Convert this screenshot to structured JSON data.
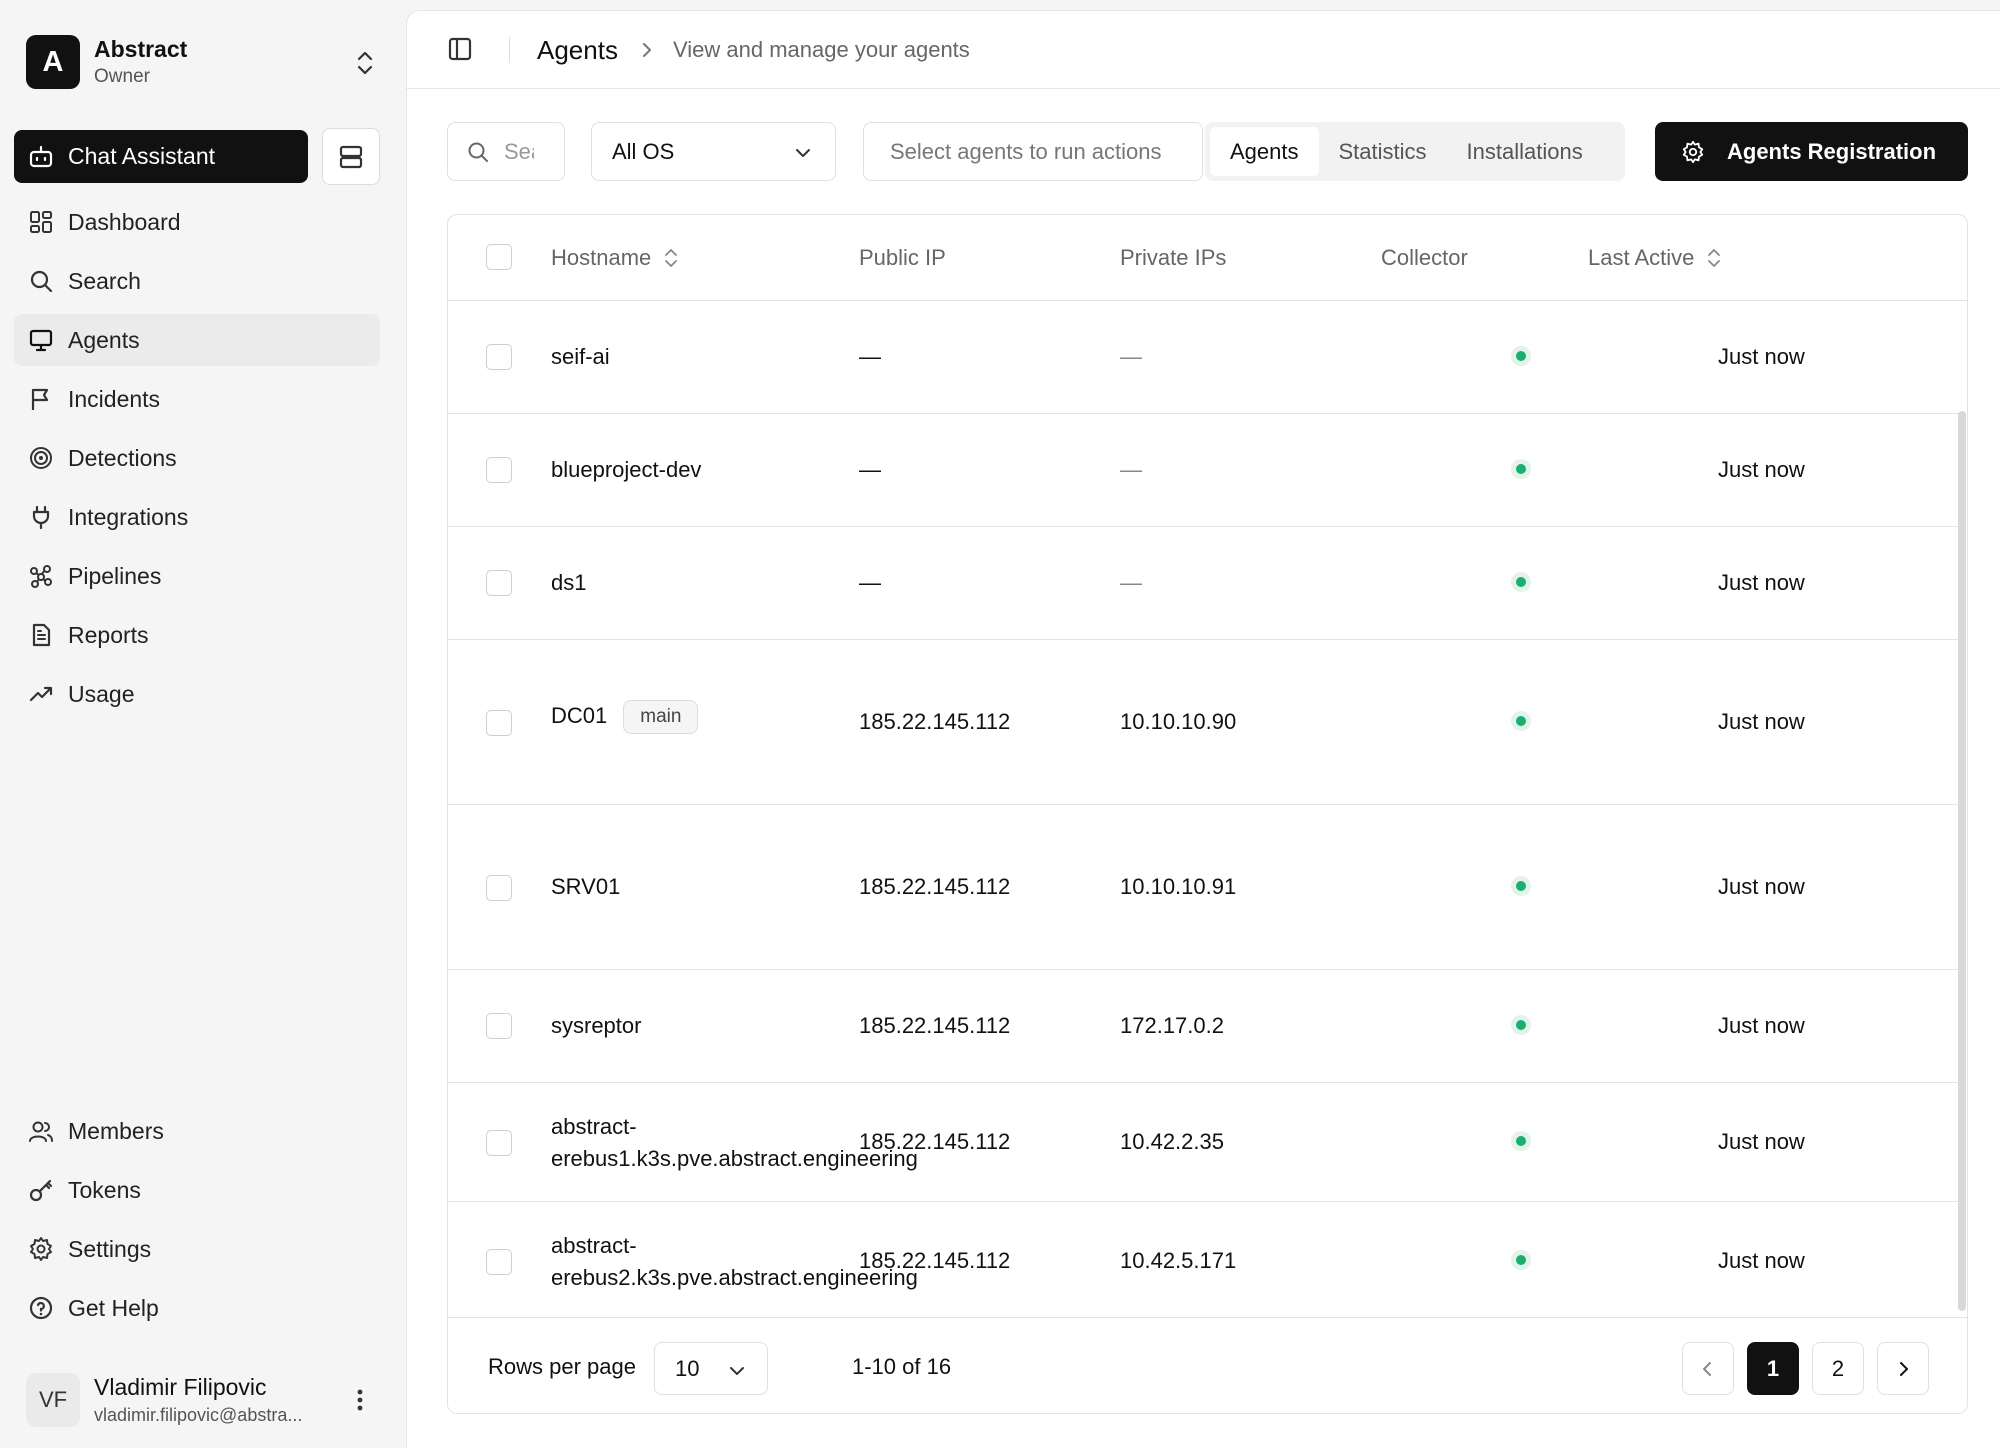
{
  "org": {
    "initial": "A",
    "name": "Abstract",
    "role": "Owner"
  },
  "sidebar": {
    "chat_label": "Chat Assistant",
    "items": [
      {
        "label": "Dashboard",
        "icon": "dashboard-icon"
      },
      {
        "label": "Search",
        "icon": "search-icon"
      },
      {
        "label": "Agents",
        "icon": "monitor-icon",
        "active": true
      },
      {
        "label": "Incidents",
        "icon": "flag-icon"
      },
      {
        "label": "Detections",
        "icon": "radar-icon"
      },
      {
        "label": "Integrations",
        "icon": "plug-icon"
      },
      {
        "label": "Pipelines",
        "icon": "workflow-icon"
      },
      {
        "label": "Reports",
        "icon": "file-text-icon"
      },
      {
        "label": "Usage",
        "icon": "trending-up-icon"
      }
    ],
    "bottom_items": [
      {
        "label": "Members",
        "icon": "users-icon"
      },
      {
        "label": "Tokens",
        "icon": "key-icon"
      },
      {
        "label": "Settings",
        "icon": "gear-icon"
      },
      {
        "label": "Get Help",
        "icon": "help-circle-icon"
      }
    ]
  },
  "user": {
    "initials": "VF",
    "name": "Vladimir Filipovic",
    "email": "vladimir.filipovic@abstra..."
  },
  "header": {
    "title": "Agents",
    "subtitle": "View and manage your agents"
  },
  "toolbar": {
    "search_placeholder": "Search",
    "os_filter": "All OS",
    "actions_placeholder": "Select agents to run actions",
    "tabs": [
      "Agents",
      "Statistics",
      "Installations"
    ],
    "active_tab": "Agents",
    "register_label": "Agents Registration"
  },
  "table": {
    "columns": {
      "hostname": "Hostname",
      "public_ip": "Public IP",
      "private_ips": "Private IPs",
      "collector": "Collector",
      "last_active": "Last Active"
    },
    "rows": [
      {
        "hostname": "seif-ai",
        "public_ip": "—",
        "private_ips": "—",
        "collector": "active",
        "last_active": "Just now"
      },
      {
        "hostname": "blueproject-dev",
        "public_ip": "—",
        "private_ips": "—",
        "collector": "active",
        "last_active": "Just now"
      },
      {
        "hostname": "ds1",
        "public_ip": "—",
        "private_ips": "—",
        "collector": "active",
        "last_active": "Just now"
      },
      {
        "hostname": "DC01",
        "tag": "main",
        "public_ip": "185.22.145.112",
        "private_ips": "10.10.10.90",
        "collector": "active",
        "last_active": "Just now"
      },
      {
        "hostname": "SRV01",
        "public_ip": "185.22.145.112",
        "private_ips": "10.10.10.91",
        "collector": "active",
        "last_active": "Just now"
      },
      {
        "hostname": "sysreptor",
        "public_ip": "185.22.145.112",
        "private_ips": "172.17.0.2",
        "collector": "active",
        "last_active": "Just now"
      },
      {
        "hostname_line1": "abstract-",
        "hostname_line2": "erebus1.k3s.pve.abstract.engineering",
        "public_ip": "185.22.145.112",
        "private_ips": "10.42.2.35",
        "collector": "active",
        "last_active": "Just now"
      },
      {
        "hostname_line1": "abstract-",
        "hostname_line2": "erebus2.k3s.pve.abstract.engineering",
        "public_ip": "185.22.145.112",
        "private_ips": "10.42.5.171",
        "collector": "active",
        "last_active": "Just now"
      }
    ]
  },
  "pagination": {
    "rows_label": "Rows per page",
    "rows_value": "10",
    "range": "1-10 of 16",
    "pages": [
      "1",
      "2"
    ],
    "current": "1"
  },
  "colors": {
    "accent": "#111111",
    "status_green": "#1aae6f"
  }
}
